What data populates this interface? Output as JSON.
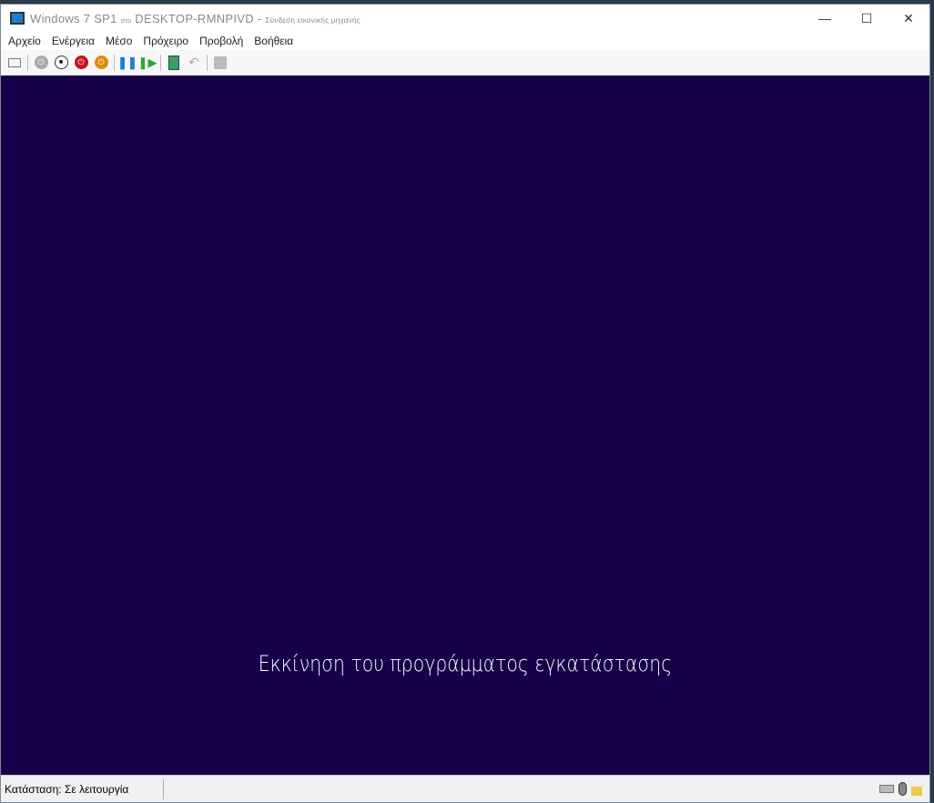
{
  "titlebar": {
    "vm": "Windows 7 SP1",
    "sto": "στο",
    "host": "DESKTOP-RMNPIVD",
    "sep": " - ",
    "app": "Σύνδεση εικονικής μηχανής"
  },
  "menu": [
    "Αρχείο",
    "Ενέργεια",
    "Μέσο",
    "Πρόχειρο",
    "Προβολή",
    "Βοήθεια"
  ],
  "screen": {
    "message": "Εκκίνηση του προγράμματος εγκατάστασης",
    "background": "#16004a"
  },
  "status": {
    "text": "Κατάσταση: Σε λειτουργία"
  }
}
